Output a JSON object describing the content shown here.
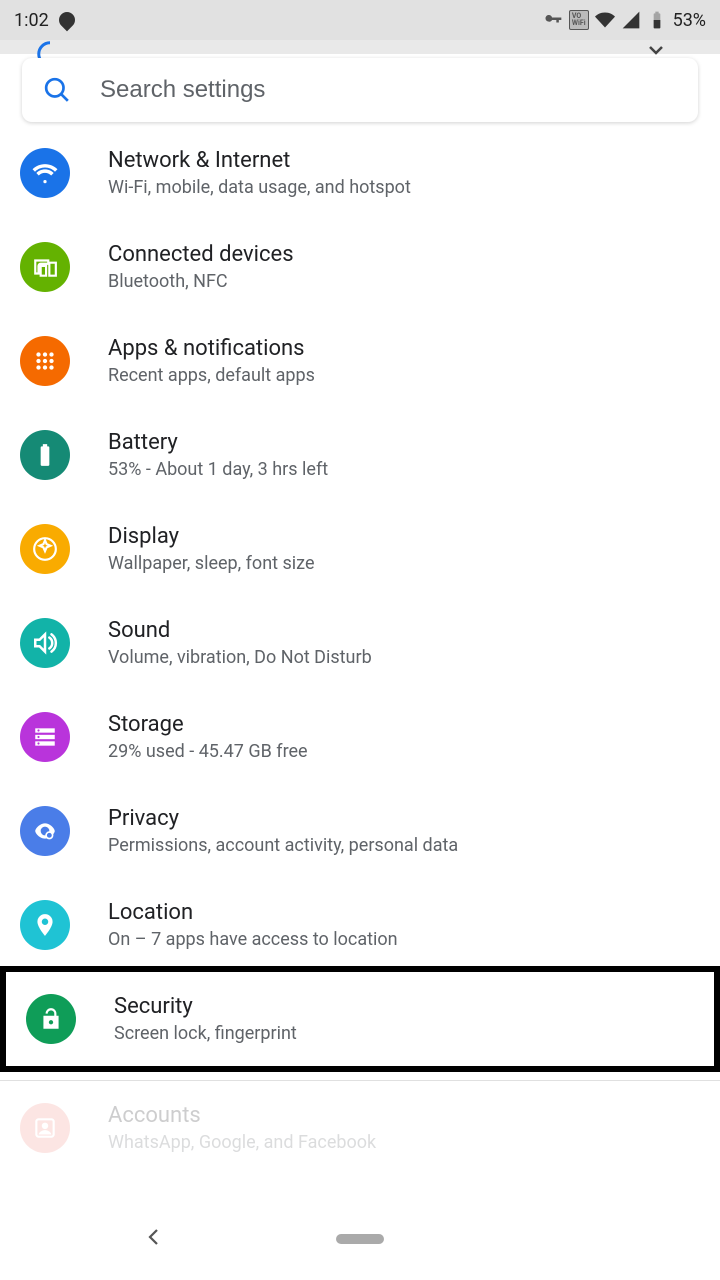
{
  "status": {
    "time": "1:02",
    "battery": "53%"
  },
  "search": {
    "placeholder": "Search settings"
  },
  "items": [
    {
      "title": "Network & Internet",
      "sub": "Wi-Fi, mobile, data usage, and hotspot",
      "color": "#1a73e8",
      "icon": "wifi"
    },
    {
      "title": "Connected devices",
      "sub": "Bluetooth, NFC",
      "color": "#64b201",
      "icon": "devices"
    },
    {
      "title": "Apps & notifications",
      "sub": "Recent apps, default apps",
      "color": "#f56a00",
      "icon": "apps"
    },
    {
      "title": "Battery",
      "sub": "53% - About 1 day, 3 hrs left",
      "color": "#158a75",
      "icon": "battery"
    },
    {
      "title": "Display",
      "sub": "Wallpaper, sleep, font size",
      "color": "#f9ab00",
      "icon": "display"
    },
    {
      "title": "Sound",
      "sub": "Volume, vibration, Do Not Disturb",
      "color": "#12b3a8",
      "icon": "sound"
    },
    {
      "title": "Storage",
      "sub": "29% used - 45.47 GB free",
      "color": "#b934db",
      "icon": "storage"
    },
    {
      "title": "Privacy",
      "sub": "Permissions, account activity, personal data",
      "color": "#4a7de8",
      "icon": "privacy"
    },
    {
      "title": "Location",
      "sub": "On – 7 apps have access to location",
      "color": "#1fc3d4",
      "icon": "location"
    },
    {
      "title": "Security",
      "sub": "Screen lock, fingerprint",
      "color": "#0f9d58",
      "icon": "security",
      "highlight": true
    },
    {
      "title": "Accounts",
      "sub": "WhatsApp, Google, and Facebook",
      "color": "#f28b82",
      "icon": "accounts",
      "fade": true,
      "divider_before": true
    }
  ]
}
